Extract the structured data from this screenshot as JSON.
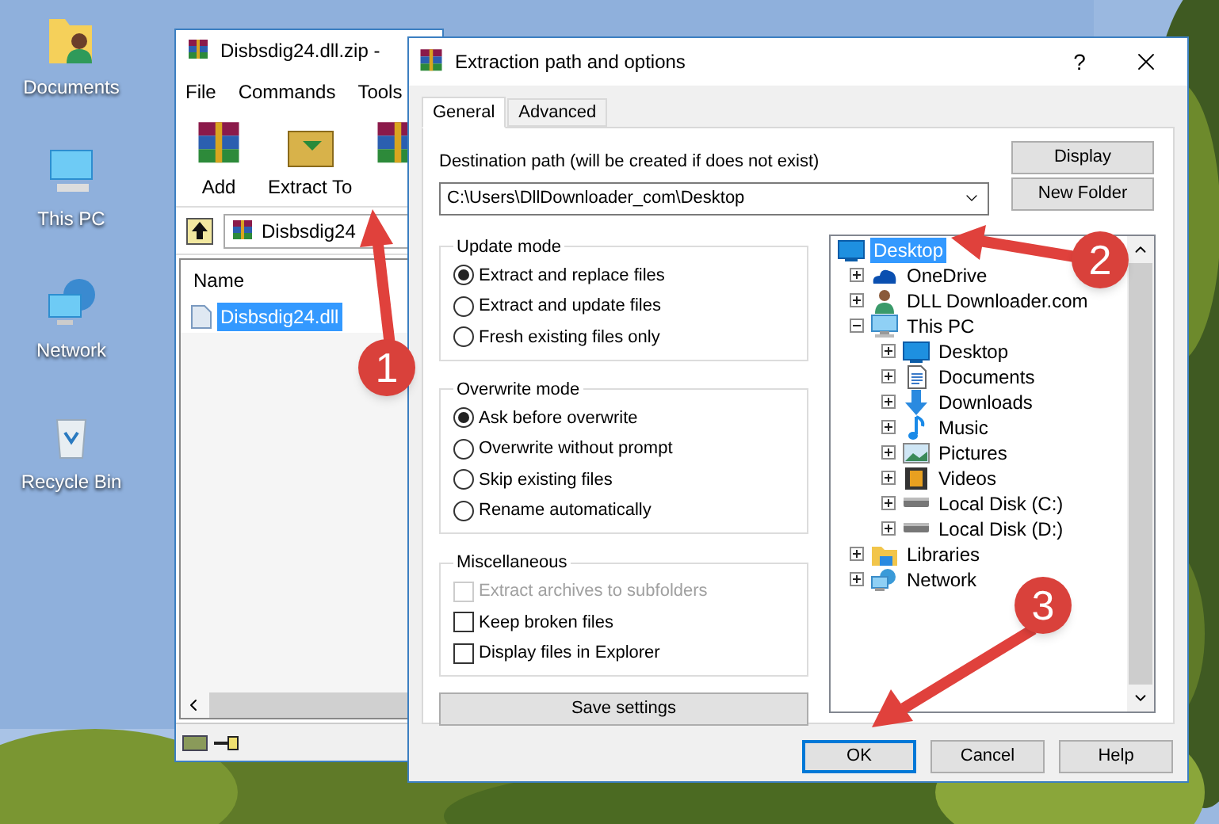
{
  "desktop_icons": [
    {
      "label": "Documents",
      "kind": "folder"
    },
    {
      "label": "This PC",
      "kind": "pc"
    },
    {
      "label": "Network",
      "kind": "network"
    },
    {
      "label": "Recycle Bin",
      "kind": "bin"
    }
  ],
  "archive_window": {
    "title": "Disbsdig24.dll.zip -",
    "menu": [
      "File",
      "Commands",
      "Tools"
    ],
    "toolbar": [
      "Add",
      "Extract To"
    ],
    "address": "Disbsdig24",
    "columns": [
      "Name"
    ],
    "files": [
      {
        "name": "Disbsdig24.dll",
        "selected": true
      }
    ]
  },
  "dialog": {
    "title": "Extraction path and options",
    "help": "?",
    "tabs": [
      {
        "label": "General",
        "selected": true
      },
      {
        "label": "Advanced",
        "selected": false
      }
    ],
    "destination_label": "Destination path (will be created if does not exist)",
    "destination_value": "C:\\Users\\DllDownloader_com\\Desktop",
    "side_buttons": [
      "Display",
      "New Folder"
    ],
    "groups": [
      {
        "title": "Update mode",
        "kind": "radio",
        "options": [
          {
            "label": "Extract and replace files",
            "selected": true
          },
          {
            "label": "Extract and update files",
            "selected": false
          },
          {
            "label": "Fresh existing files only",
            "selected": false
          }
        ]
      },
      {
        "title": "Overwrite mode",
        "kind": "radio",
        "options": [
          {
            "label": "Ask before overwrite",
            "selected": true
          },
          {
            "label": "Overwrite without prompt",
            "selected": false
          },
          {
            "label": "Skip existing files",
            "selected": false
          },
          {
            "label": "Rename automatically",
            "selected": false
          }
        ]
      },
      {
        "title": "Miscellaneous",
        "kind": "checkbox",
        "options": [
          {
            "label": "Extract archives to subfolders",
            "checked": false,
            "disabled": true
          },
          {
            "label": "Keep broken files",
            "checked": false,
            "disabled": false
          },
          {
            "label": "Display files in Explorer",
            "checked": false,
            "disabled": false
          }
        ]
      }
    ],
    "save_button": "Save settings",
    "tree": [
      {
        "label": "Desktop",
        "kind": "screen",
        "selected": true,
        "children": [
          {
            "label": "OneDrive",
            "kind": "cloud",
            "selected": false,
            "expanded": false
          },
          {
            "label": "DLL Downloader.com",
            "kind": "user",
            "selected": false,
            "expanded": false
          },
          {
            "label": "This PC",
            "kind": "pc",
            "selected": false,
            "expanded": true,
            "children": [
              {
                "label": "Desktop",
                "kind": "screen",
                "selected": false,
                "expanded": false
              },
              {
                "label": "Documents",
                "kind": "doc",
                "selected": false,
                "expanded": false
              },
              {
                "label": "Downloads",
                "kind": "download",
                "selected": false,
                "expanded": false
              },
              {
                "label": "Music",
                "kind": "music",
                "selected": false,
                "expanded": false
              },
              {
                "label": "Pictures",
                "kind": "picture",
                "selected": false,
                "expanded": false
              },
              {
                "label": "Videos",
                "kind": "video",
                "selected": false,
                "expanded": false
              },
              {
                "label": "Local Disk (C:)",
                "kind": "disk",
                "selected": false,
                "expanded": false
              },
              {
                "label": "Local Disk (D:)",
                "kind": "disk",
                "selected": false,
                "expanded": false
              }
            ]
          },
          {
            "label": "Libraries",
            "kind": "folder",
            "selected": false,
            "expanded": false
          },
          {
            "label": "Network",
            "kind": "network",
            "selected": false,
            "expanded": false
          }
        ]
      }
    ],
    "buttons": [
      {
        "label": "OK",
        "focused": true
      },
      {
        "label": "Cancel",
        "focused": false
      },
      {
        "label": "Help",
        "focused": false
      }
    ]
  },
  "callouts": [
    {
      "label": "1"
    },
    {
      "label": "2"
    },
    {
      "label": "3"
    }
  ]
}
